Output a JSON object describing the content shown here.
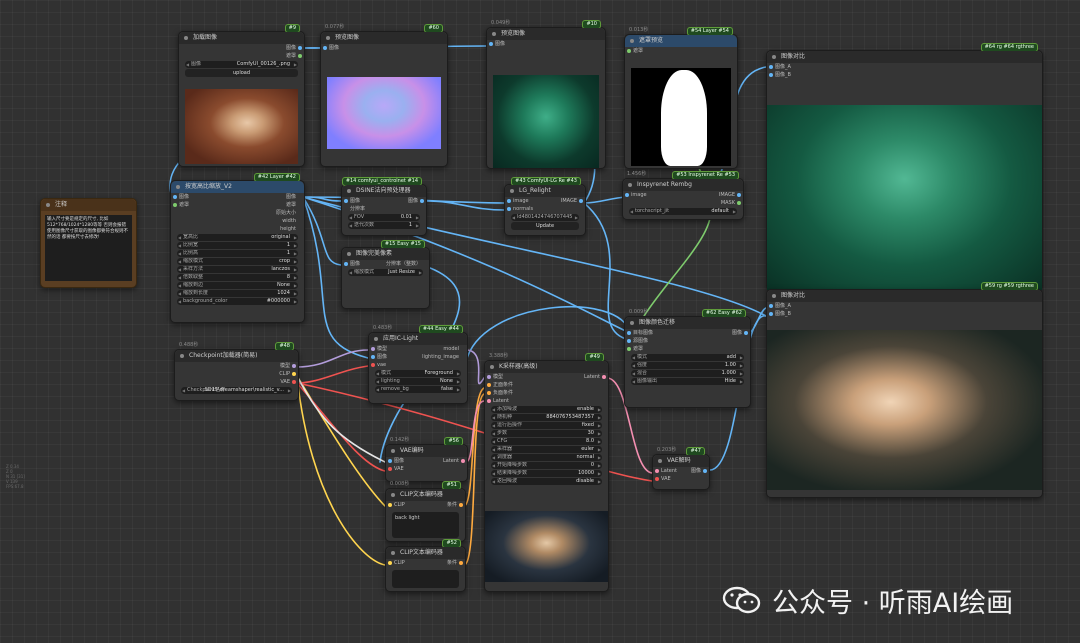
{
  "nodes": {
    "load_image": {
      "id": "#9",
      "title": "加载图像",
      "out1": "图像",
      "out2": "遮罩",
      "widget_label": "图像",
      "widget_value": "ComfyUI_00126_.png",
      "button": "upload"
    },
    "preview1": {
      "id": "#60",
      "timing": "0.077秒",
      "title": "预览图像",
      "in1": "图像"
    },
    "preview2": {
      "id": "#10",
      "timing": "0.049秒",
      "title": "预览图像",
      "in1": "图像"
    },
    "mask_preview": {
      "id": "#54 Layer #54",
      "timing": "0.013秒",
      "title": "遮罩预览",
      "in1": "遮罩"
    },
    "compare1": {
      "id": "#64 rg #64 rgthree",
      "title": "图像对比",
      "in1": "图像_A",
      "in2": "图像_B"
    },
    "compare2": {
      "id": "#59 rg #59 rgthree",
      "title": "图像对比",
      "in1": "图像_A",
      "in2": "图像_B"
    },
    "note": {
      "title": "注释",
      "text": "输入尺寸要是规定的尺寸, 比如512*768/1024*1280等等 否则会报错 使用图像尺寸获取的图像都要符合规则不然的话 都要按尺寸去修改!"
    },
    "scale": {
      "id": "#42 Layer #42",
      "title": "按宽高比缩放_V2",
      "in1": "图像",
      "in2": "遮罩",
      "outs": [
        "图像",
        "遮罩",
        "原始大小",
        "width",
        "height"
      ],
      "widgets": [
        [
          "宽高比",
          "original"
        ],
        [
          "比例宽",
          "1"
        ],
        [
          "比例高",
          "1"
        ],
        [
          "缩放模式",
          "crop"
        ],
        [
          "采样方法",
          "lanczos"
        ],
        [
          "倍数取整",
          "8"
        ],
        [
          "缩放到边",
          "None"
        ],
        [
          "缩放到长度",
          "1024"
        ],
        [
          "background_color",
          "#000000"
        ]
      ]
    },
    "dsine": {
      "id": "#14 comfyui_controlnet #14",
      "title": "DSINE法向预处理器",
      "in1": "图像",
      "out1": "图像",
      "out2": "分辨率",
      "widgets": [
        [
          "FOV",
          "0.01"
        ],
        [
          "迭代次数",
          "1"
        ]
      ]
    },
    "lg_relight": {
      "id": "#43 ComfyUI-LG Re #43",
      "title": "LG_Relight",
      "in1": "image",
      "in2": "normals",
      "out1": "IMAGE",
      "seed": "ld4801424746707445",
      "button": "Update"
    },
    "inspyrenet": {
      "id": "#53 Inspyrenet Re #53",
      "timing": "1.456秒",
      "title": "Inspyrenet Rembg",
      "in1": "image",
      "out1": "IMAGE",
      "out2": "MASK",
      "widget_label": "torchscript_jit",
      "widget_value": "default"
    },
    "resize": {
      "id": "#15 Easy #15",
      "title": "图像完美像素",
      "in1": "图像",
      "out1": "分辨率（整数）",
      "widget_label": "缩放模式",
      "widget_value": "Just Resize"
    },
    "color_transfer": {
      "id": "#62 Easy #62",
      "timing": "0.009秒",
      "title": "图像颜色迁移",
      "in1": "目标图像",
      "in2": "源图像",
      "in3": "遮罩",
      "out1": "图像",
      "widgets": [
        [
          "模式",
          "add"
        ],
        [
          "强度",
          "1.00"
        ],
        [
          "混合",
          "1.000"
        ],
        [
          "图像输出",
          "Hide"
        ]
      ]
    },
    "iclight": {
      "id": "#44 Easy #44",
      "timing": "0.483秒",
      "title": "应用IC-Light",
      "in1": "模型",
      "in2": "图像",
      "in3": "vae",
      "out1": "model",
      "out2": "lighting_image",
      "widgets": [
        [
          "模式",
          "Foreground"
        ],
        [
          "lighting",
          "None"
        ],
        [
          "remove_bg",
          "false"
        ]
      ]
    },
    "checkpoint": {
      "id": "#48",
      "timing": "0.488秒",
      "title": "Checkpoint加载器(简易)",
      "outs": [
        "模型",
        "CLIP",
        "VAE"
      ],
      "widget_label": "Checkpoint名称",
      "widget_value": "SD15\\dreamshaper\\realistic_v..."
    },
    "ksampler": {
      "id": "#49",
      "timing": "3.388秒",
      "title": "K采样器(高级)",
      "ins": [
        "模型",
        "正面条件",
        "负面条件",
        "Latent"
      ],
      "out1": "Latent",
      "widgets": [
        [
          "添加噪波",
          "enable"
        ],
        [
          "随机种",
          "884076753487357"
        ],
        [
          "运行后操作",
          "fixed"
        ],
        [
          "步数",
          "30"
        ],
        [
          "CFG",
          "8.0"
        ],
        [
          "采样器",
          "euler"
        ],
        [
          "调度器",
          "normal"
        ],
        [
          "开始降噪步数",
          "0"
        ],
        [
          "结束降噪步数",
          "10000"
        ],
        [
          "返回噪波",
          "disable"
        ]
      ]
    },
    "vae_encode": {
      "id": "#56",
      "timing": "0.142秒",
      "title": "VAE编码",
      "in1": "图像",
      "in2": "VAE",
      "out1": "Latent"
    },
    "clip_pos": {
      "id": "#51",
      "timing": "0.008秒",
      "title": "CLIP文本编码器",
      "in1": "CLIP",
      "out1": "条件",
      "text": "back light"
    },
    "clip_neg": {
      "id": "#52",
      "title": "CLIP文本编码器",
      "in1": "CLIP",
      "out1": "条件"
    },
    "vae_decode": {
      "id": "#47",
      "timing": "0.203秒",
      "title": "VAE解码",
      "in1": "Latent",
      "in2": "VAE",
      "out1": "图像"
    }
  },
  "side_info": [
    "Z 0.34",
    "Z 0",
    "N 31 [31]",
    "V 139",
    "FPS:67.8"
  ],
  "watermark": {
    "text": "公众号 · 听雨AI绘画"
  },
  "colors": {
    "wire_image": "#64b5f6",
    "wire_mask": "#7ecb6d",
    "wire_model": "#b39ddb",
    "wire_clip": "#ffd54f",
    "wire_vae": "#ef5350",
    "wire_cond": "#ffab40",
    "wire_latent": "#f48fb1"
  }
}
